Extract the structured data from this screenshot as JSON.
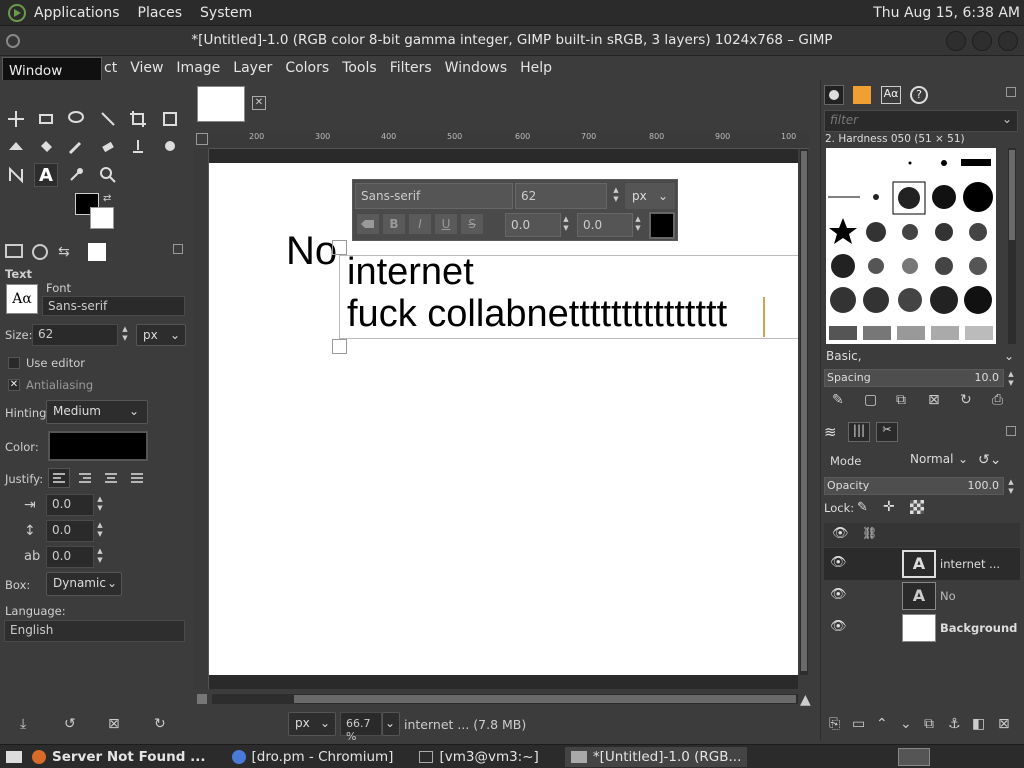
{
  "top_panel": {
    "menus": [
      "Applications",
      "Places",
      "System"
    ],
    "clock": "Thu Aug 15,  6:38 AM"
  },
  "window": {
    "title": "*[Untitled]-1.0 (RGB color 8-bit gamma integer, GIMP built-in sRGB, 3 layers) 1024x768 – GIMP"
  },
  "tooltip": "Window Menu",
  "menubar": [
    "ct",
    "View",
    "Image",
    "Layer",
    "Colors",
    "Tools",
    "Filters",
    "Windows",
    "Help"
  ],
  "tool_options": {
    "section_title": "Text",
    "font_label": "Font",
    "font_value": "Sans-serif",
    "font_preview": "Aα",
    "size_label": "Size:",
    "size_value": "62",
    "size_unit": "px",
    "use_editor_label": "Use editor",
    "antialiasing_label": "Antialiasing",
    "hinting_label": "Hinting:",
    "hinting_value": "Medium",
    "color_label": "Color:",
    "justify_label": "Justify:",
    "indent_value": "0.0",
    "line_spacing_value": "0.0",
    "letter_spacing_value": "0.0",
    "box_label": "Box:",
    "box_value": "Dynamic",
    "language_label": "Language:",
    "language_value": "English"
  },
  "canvas": {
    "text_no": "No",
    "text_line1": "internet",
    "text_line2": "fuck collabnettttttttttttttt",
    "ruler_marks": [
      "200",
      "300",
      "400",
      "500",
      "600",
      "700",
      "800",
      "900",
      "100"
    ]
  },
  "text_toolbar": {
    "font": "Sans-serif",
    "size": "62",
    "unit": "px",
    "baseline": "0.0",
    "kerning": "0.0"
  },
  "status_bar": {
    "unit": "px",
    "zoom": "66.7 %",
    "message": "internet ... (7.8 MB)"
  },
  "brushes": {
    "filter_placeholder": "filter",
    "selected_brush": "2. Hardness 050 (51 × 51)",
    "preset": "Basic,",
    "spacing_label": "Spacing",
    "spacing_value": "10.0"
  },
  "layers": {
    "mode_label": "Mode",
    "mode_value": "Normal",
    "opacity_label": "Opacity",
    "opacity_value": "100.0",
    "lock_label": "Lock:",
    "items": [
      {
        "name": "internet ...",
        "type": "text"
      },
      {
        "name": "No",
        "type": "text"
      },
      {
        "name": "Background",
        "type": "image"
      }
    ]
  },
  "taskbar": {
    "items": [
      "Server Not Found ...",
      "[dro.pm - Chromium]",
      "[vm3@vm3:~]",
      "*[Untitled]-1.0 (RGB..."
    ]
  },
  "colors": {
    "foreground": "#000000",
    "background": "#ffffff",
    "panel": "#3c3c3c"
  }
}
